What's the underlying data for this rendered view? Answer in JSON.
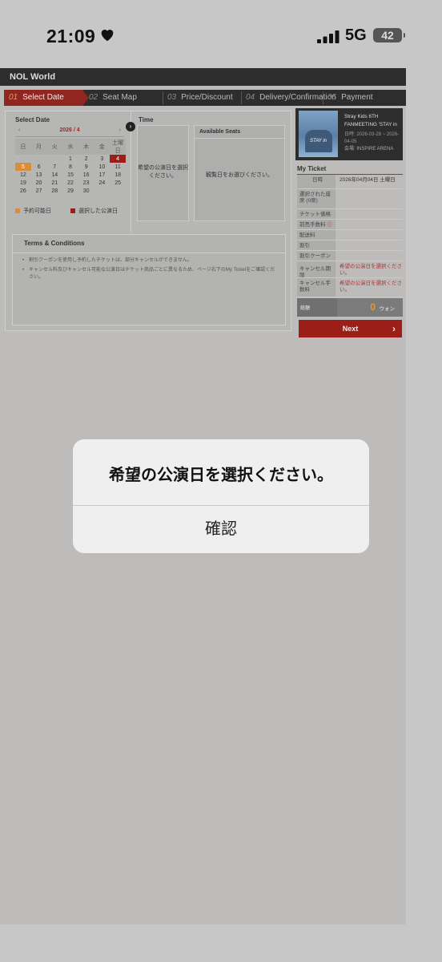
{
  "status_bar": {
    "time": "21:09",
    "network": "5G",
    "battery": "42"
  },
  "brand": "NOL World",
  "steps": [
    {
      "num": "01",
      "label": "Select Date"
    },
    {
      "num": "02",
      "label": "Seat Map"
    },
    {
      "num": "03",
      "label": "Price/Discount"
    },
    {
      "num": "04",
      "label": "Delivery/Confirmation"
    },
    {
      "num": "05",
      "label": "Payment"
    }
  ],
  "select_date": {
    "title": "Select Date",
    "month": "2026 / 4",
    "prev": "‹",
    "next": "›",
    "weekdays": [
      "日",
      "月",
      "火",
      "水",
      "木",
      "金",
      "土曜日"
    ],
    "weeks": [
      [
        "",
        "",
        "",
        "1",
        "2",
        "3",
        "4"
      ],
      [
        "5",
        "6",
        "7",
        "8",
        "9",
        "10",
        "11"
      ],
      [
        "12",
        "13",
        "14",
        "15",
        "16",
        "17",
        "18"
      ],
      [
        "19",
        "20",
        "21",
        "22",
        "23",
        "24",
        "25"
      ],
      [
        "26",
        "27",
        "28",
        "29",
        "30",
        "",
        ""
      ]
    ],
    "available_day": "5",
    "selected_day": "4",
    "legend_available": "予約可能日",
    "legend_selected": "選択した公演日"
  },
  "time": {
    "title": "Time",
    "message": "希望の公演日を選択ください。"
  },
  "available_seats": {
    "title": "Available Seats",
    "message": "観覧日をお選びください。"
  },
  "terms": {
    "title": "Terms & Conditions",
    "items": [
      "割引クーポンを使用し予約したチケットは、部分キャンセルができません。",
      "キャンセル料及びキャンセル可能な公演日はチケット商品ごとに異なるため、ページ右下のMy Ticketをご確認ください。"
    ]
  },
  "event": {
    "title": "Stray Kids 6TH FANMEETING 'STAY in",
    "dates": "日時: 2026-03-28 ~ 2026-04-05",
    "venue": "会場: INSPIRE ARENA",
    "poster_text": "STAY in"
  },
  "my_ticket": {
    "title": "My Ticket",
    "rows": [
      {
        "label": "日時",
        "value": "2026年04月04日 土曜日"
      },
      {
        "label": "選択された座席 (0席)",
        "value": ""
      },
      {
        "label": "チケット価格",
        "value": ""
      },
      {
        "label": "前売手数料",
        "value": ""
      },
      {
        "label": "配送料",
        "value": ""
      },
      {
        "label": "割引",
        "value": ""
      },
      {
        "label": "割引クーポン",
        "value": ""
      },
      {
        "label": "キャンセル期限",
        "value": "希望の公演日を選択ください。"
      },
      {
        "label": "キャンセル手数料",
        "value": "希望の公演日を選択ください。"
      }
    ],
    "total_label": "総額",
    "total_value": "0",
    "total_unit": "ウォン",
    "next_label": "Next"
  },
  "dialog": {
    "message": "希望の公演日を選択ください。",
    "ok_label": "確認"
  }
}
